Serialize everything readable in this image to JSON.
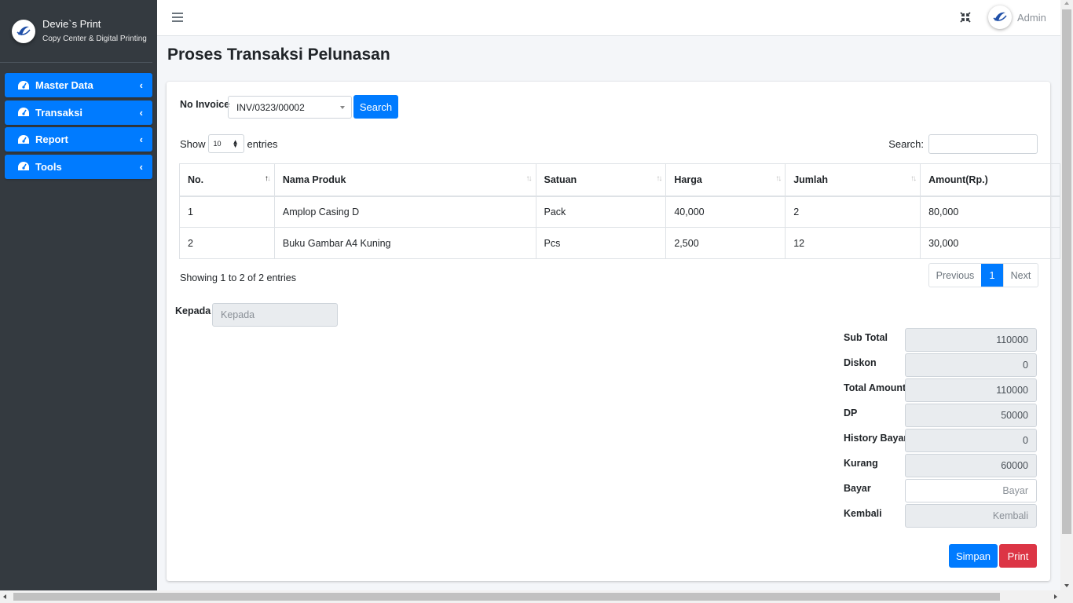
{
  "brand": {
    "name": "Devie`s Print",
    "subtitle": "Copy Center & Digital Printing"
  },
  "sidebar": {
    "items": [
      {
        "label": "Master Data",
        "icon": "tachometer-icon"
      },
      {
        "label": "Transaksi",
        "icon": "tachometer-icon"
      },
      {
        "label": "Report",
        "icon": "tachometer-icon"
      },
      {
        "label": "Tools",
        "icon": "tachometer-icon"
      }
    ]
  },
  "topbar": {
    "user_name": "Admin"
  },
  "page": {
    "title": "Proses Transaksi Pelunasan"
  },
  "invoice": {
    "label": "No Invoice",
    "selected": "INV/0323/00002",
    "search_button": "Search"
  },
  "table_controls": {
    "show_label": "Show",
    "length_value": "10",
    "entries_label": "entries",
    "search_label": "Search:"
  },
  "table": {
    "columns": [
      "No.",
      "Nama Produk",
      "Satuan",
      "Harga",
      "Jumlah",
      "Amount(Rp.)"
    ],
    "rows": [
      [
        "1",
        "Amplop Casing D",
        "Pack",
        "40,000",
        "2",
        "80,000"
      ],
      [
        "2",
        "Buku Gambar A4 Kuning",
        "Pcs",
        "2,500",
        "12",
        "30,000"
      ]
    ]
  },
  "table_info": "Showing 1 to 2 of 2 entries",
  "pagination": {
    "previous": "Previous",
    "current": "1",
    "next": "Next"
  },
  "kepada": {
    "label": "Kepada",
    "placeholder": "Kepada"
  },
  "summary": [
    {
      "label": "Sub Total",
      "value": "110000"
    },
    {
      "label": "Diskon",
      "value": "0"
    },
    {
      "label": "Total Amount",
      "value": "110000"
    },
    {
      "label": "DP",
      "value": "50000"
    },
    {
      "label": "History Bayar",
      "value": "0"
    },
    {
      "label": "Kurang",
      "value": "60000"
    },
    {
      "label": "Bayar",
      "placeholder": "Bayar"
    },
    {
      "label": "Kembali",
      "placeholder": "Kembali"
    }
  ],
  "actions": {
    "save": "Simpan",
    "print": "Print"
  },
  "colors": {
    "primary": "#007bff",
    "danger": "#dc3545",
    "sidebar": "#343a40"
  }
}
